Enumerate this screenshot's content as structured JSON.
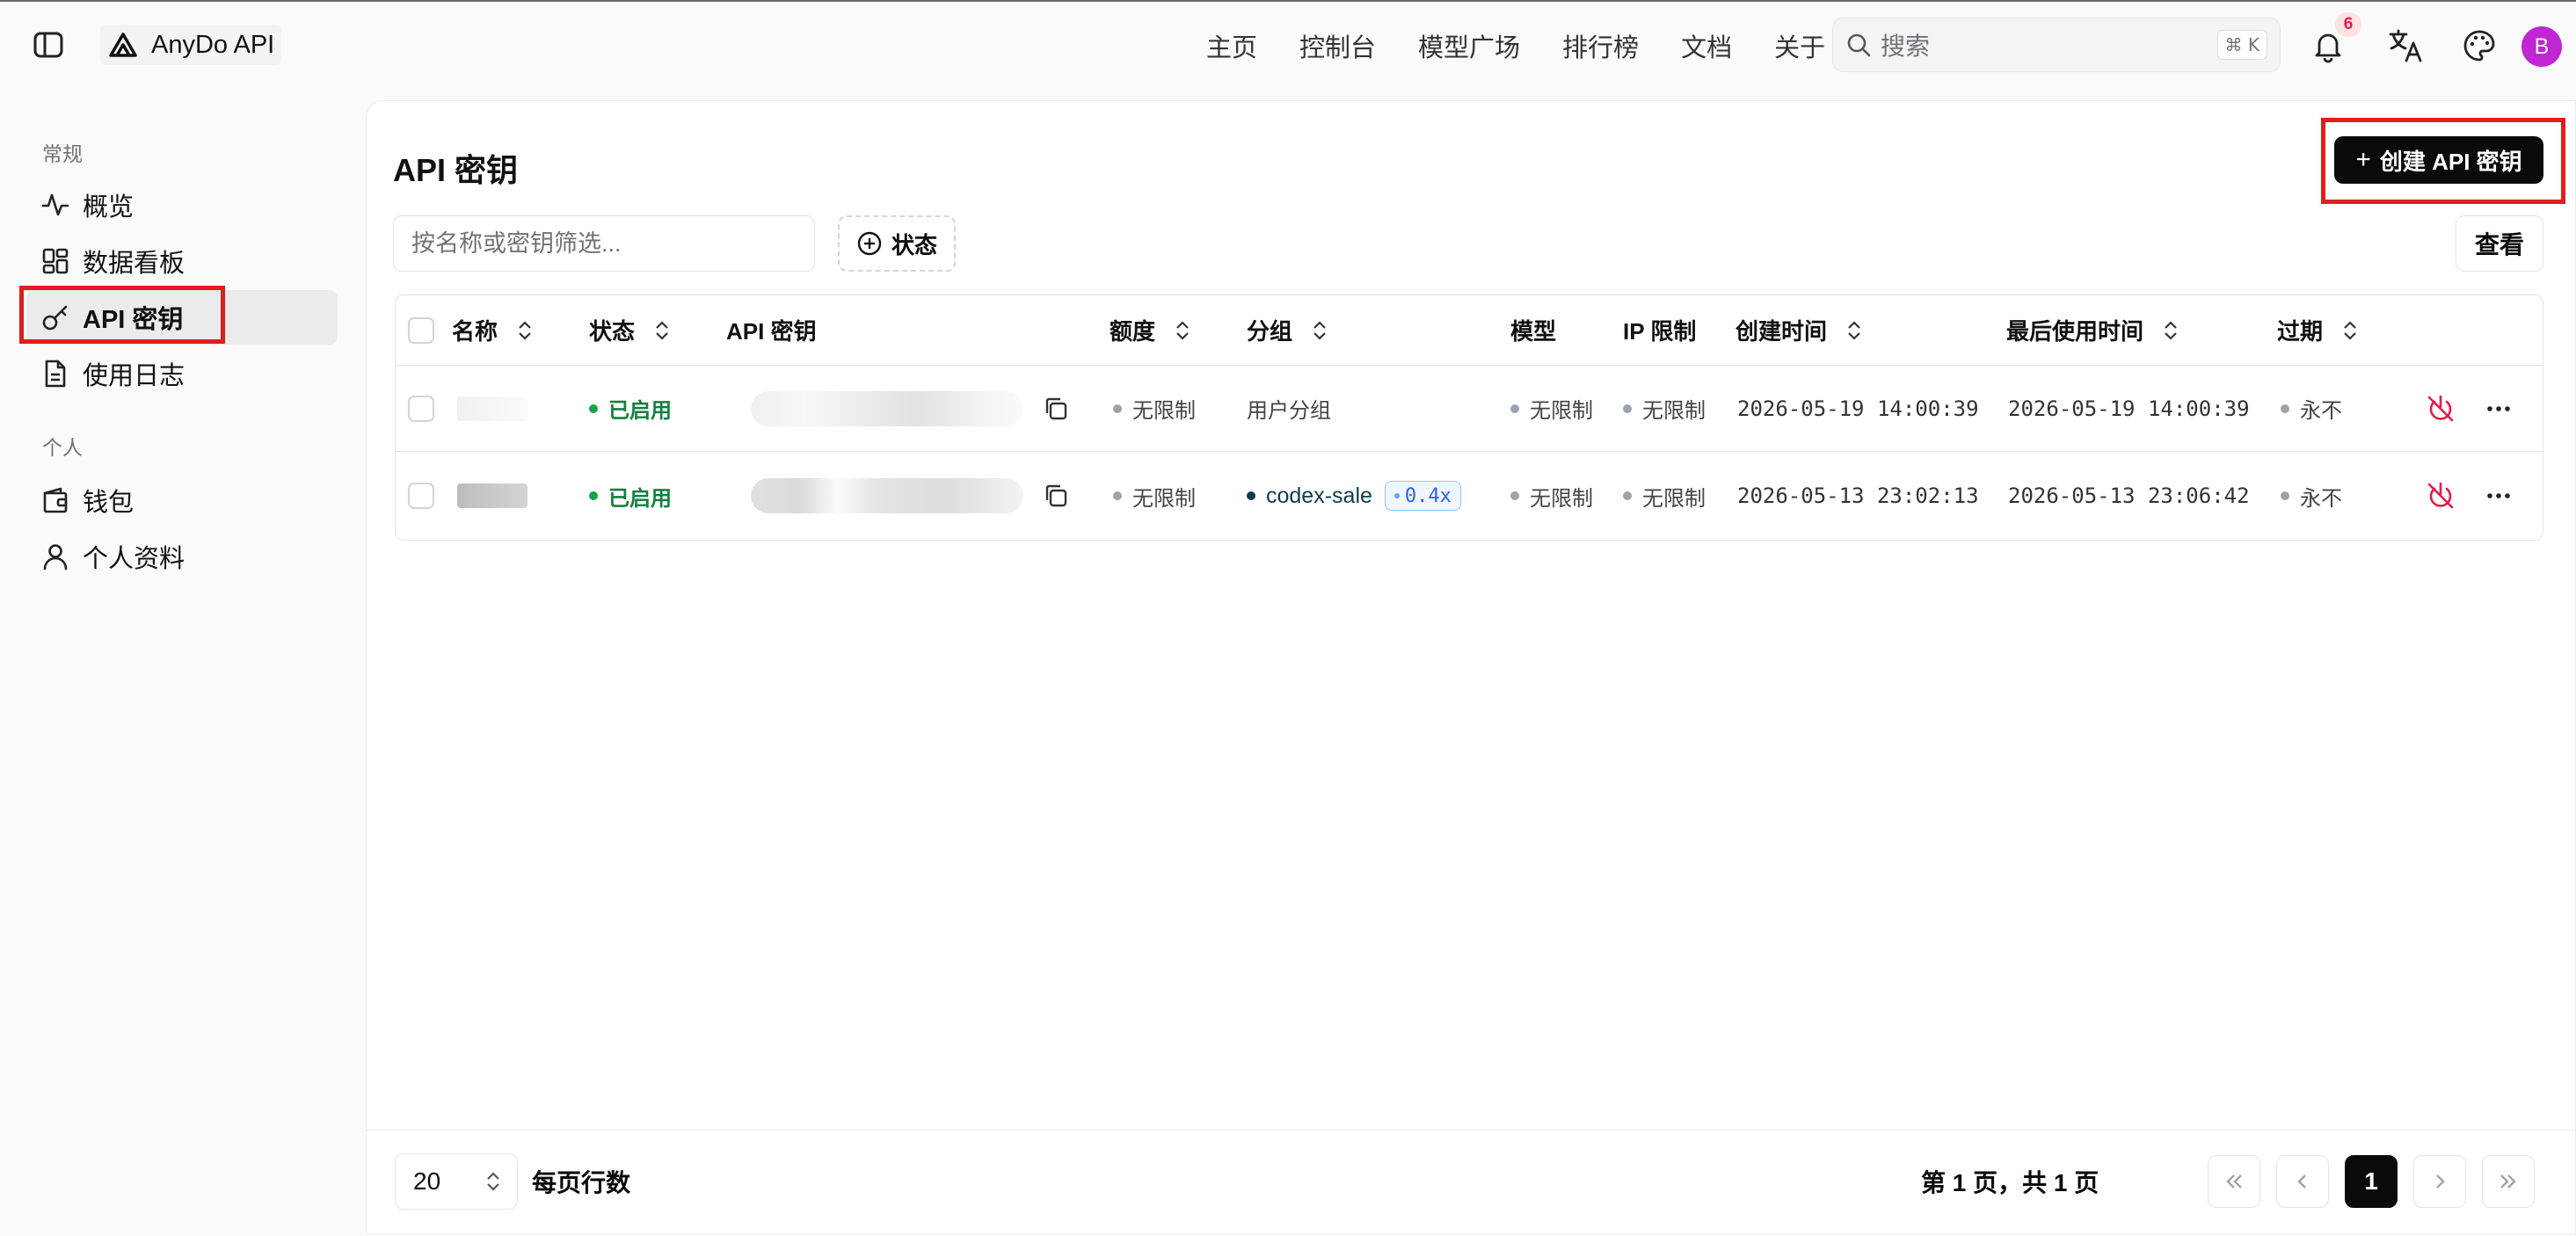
{
  "app": {
    "brand": "AnyDo API",
    "nav": [
      "主页",
      "控制台",
      "模型广场",
      "排行榜",
      "文档",
      "关于"
    ],
    "search_placeholder": "搜索",
    "search_shortcut": "⌘ K",
    "notification_count": "6",
    "avatar_initial": "B"
  },
  "sidebar": {
    "sections": [
      {
        "label": "常规",
        "items": [
          "概览",
          "数据看板",
          "API 密钥",
          "使用日志"
        ]
      },
      {
        "label": "个人",
        "items": [
          "钱包",
          "个人资料"
        ]
      }
    ],
    "active_item": "API 密钥"
  },
  "page": {
    "title": "API 密钥",
    "create_button": "创建 API 密钥",
    "filter_placeholder": "按名称或密钥筛选...",
    "status_filter": "状态",
    "view_button": "查看"
  },
  "table": {
    "columns": [
      "名称",
      "状态",
      "API 密钥",
      "额度",
      "分组",
      "模型",
      "IP 限制",
      "创建时间",
      "最后使用时间",
      "过期"
    ],
    "rows": [
      {
        "status": "已启用",
        "quota": "无限制",
        "group": "用户分组",
        "model": "无限制",
        "ip_limit": "无限制",
        "created": "2026-05-19 14:00:39",
        "last_used": "2026-05-19 14:00:39",
        "expire": "永不"
      },
      {
        "status": "已启用",
        "quota": "无限制",
        "group": "codex-sale",
        "group_ratio": "0.4x",
        "model": "无限制",
        "ip_limit": "无限制",
        "created": "2026-05-13 23:02:13",
        "last_used": "2026-05-13 23:06:42",
        "expire": "永不"
      }
    ]
  },
  "pagination": {
    "page_size": "20",
    "rows_per_page_label": "每页行数",
    "page_info": "第 1 页，共 1 页",
    "current_page": "1"
  },
  "colors": {
    "accent": "#0a0a0a",
    "enabled_green": "#15803d",
    "highlight_red": "#e11d1d",
    "avatar": "#c026d3"
  }
}
